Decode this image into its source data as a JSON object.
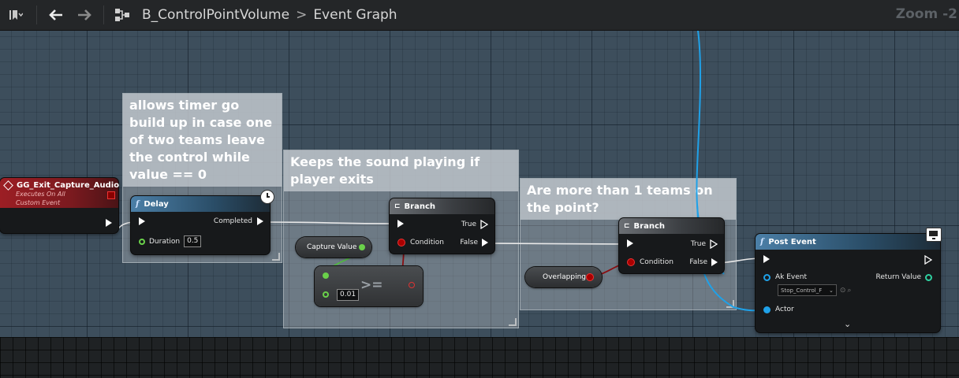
{
  "toolbar": {
    "breadcrumb_path": "B_ControlPointVolume",
    "breadcrumb_separator": ">",
    "breadcrumb_current": "Event Graph",
    "zoom": "Zoom -2"
  },
  "comments": [
    {
      "text": "allows timer go build up in case one of two teams leave the control while value == 0"
    },
    {
      "text": "Keeps the sound playing if player exits"
    },
    {
      "text": "Are more than 1 teams on the point?"
    }
  ],
  "nodes": {
    "custom_event": {
      "title": "GG_Exit_Capture_Audio",
      "subtitle_1": "Executes On All",
      "subtitle_2": "Custom Event"
    },
    "delay": {
      "title": "Delay",
      "out_label": "Completed",
      "duration_label": "Duration",
      "duration_value": "0.5"
    },
    "branch_1": {
      "title": "Branch",
      "true_label": "True",
      "false_label": "False",
      "condition_label": "Condition"
    },
    "branch_2": {
      "title": "Branch",
      "true_label": "True",
      "false_label": "False",
      "condition_label": "Condition"
    },
    "capture_value": {
      "label": "Capture Value"
    },
    "compare": {
      "operator": ">=",
      "value": "0.01"
    },
    "overlapping": {
      "label": "Overlapping"
    },
    "post_event": {
      "title": "Post Event",
      "ak_event_label": "Ak Event",
      "ak_event_value": "Stop_Control_F",
      "return_label": "Return Value",
      "actor_label": "Actor"
    }
  },
  "colors": {
    "exec_wire": "#ffffff",
    "bool_wire": "#8a0f12",
    "float_wire": "#4fbf3b",
    "object_wire": "#1fa1e8"
  }
}
